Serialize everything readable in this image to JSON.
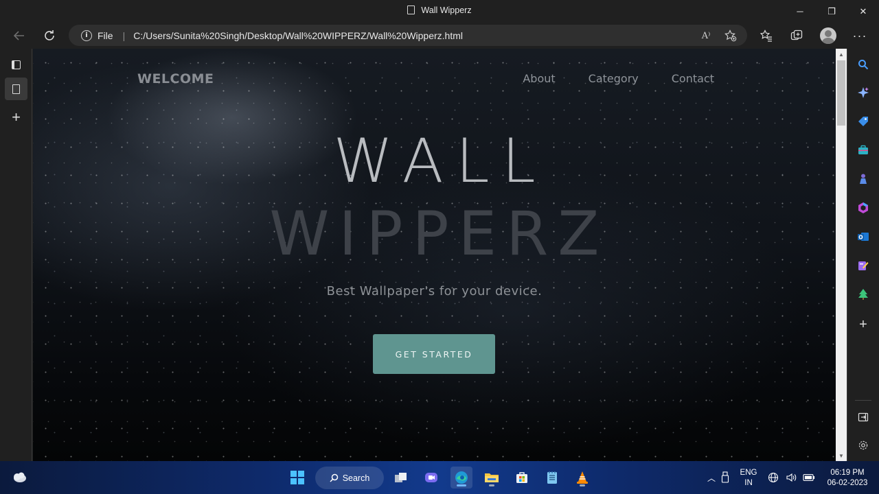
{
  "window": {
    "title": "Wall Wipperz",
    "minimize_glyph": "─",
    "maximize_glyph": "❐",
    "close_glyph": "✕"
  },
  "address_bar": {
    "protocol_label": "File",
    "url": "C:/Users/Sunita%20Singh/Desktop/Wall%20WIPPERZ/Wall%20Wipperz.html",
    "read_aloud_icon": "A⁾",
    "separator": "|"
  },
  "page": {
    "brand": "WELCOME",
    "nav": [
      "About",
      "Category",
      "Contact"
    ],
    "hero_line1": "WALL",
    "hero_line2": "WIPPERZ",
    "tagline": "Best Wallpaper's for your device.",
    "cta_label": "GET STARTED",
    "accent_color": "#5f9590"
  },
  "sidebar_right": {
    "icons": [
      "search-icon",
      "copilot-icon",
      "shopping-tag-icon",
      "tools-briefcase-icon",
      "games-icon",
      "office-icon",
      "outlook-icon",
      "designer-icon",
      "tree-icon",
      "add-icon",
      "split-screen-icon",
      "settings-icon"
    ]
  },
  "taskbar": {
    "search_label": "Search",
    "lang_top": "ENG",
    "lang_bottom": "IN",
    "time": "06:19 PM",
    "date": "06-02-2023"
  }
}
